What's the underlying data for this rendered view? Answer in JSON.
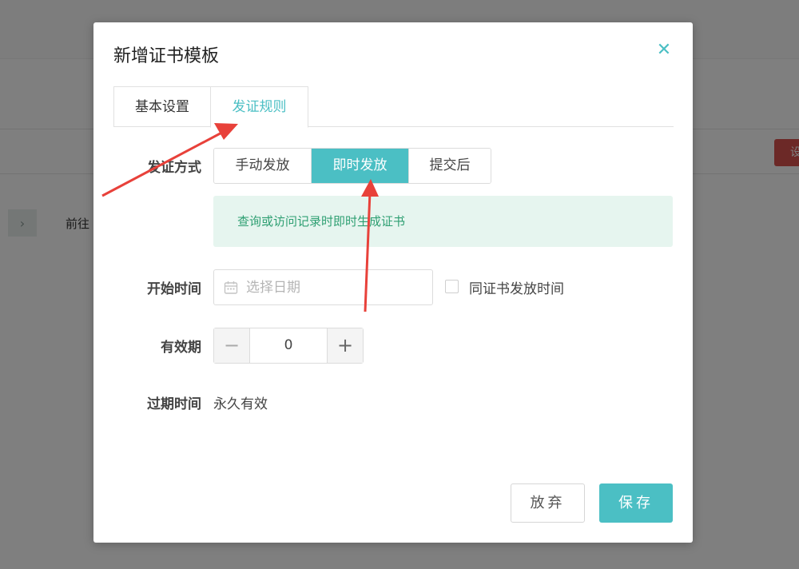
{
  "background": {
    "next_button_label": "前往",
    "red_button_label": "设"
  },
  "modal": {
    "title": "新增证书模板",
    "tabs": [
      {
        "label": "基本设置",
        "active": false
      },
      {
        "label": "发证规则",
        "active": true
      }
    ],
    "issue_method": {
      "label": "发证方式",
      "options": [
        "手动发放",
        "即时发放",
        "提交后"
      ],
      "selected": "即时发放",
      "hint": "查询或访问记录时即时生成证书"
    },
    "start_time": {
      "label": "开始时间",
      "placeholder": "选择日期",
      "value": "",
      "same_as_issue_label": "同证书发放时间",
      "same_as_issue_checked": false
    },
    "validity": {
      "label": "有效期",
      "value": "0",
      "minus": "−",
      "plus": "+"
    },
    "expire": {
      "label": "过期时间",
      "value": "永久有效"
    },
    "buttons": {
      "abandon": "放弃",
      "save": "保存"
    }
  },
  "colors": {
    "accent": "#4bbfc4",
    "hint_bg": "#e6f5ef",
    "hint_text": "#2e9f72",
    "annotation_arrow": "#e8413a"
  },
  "icons": {
    "close": "close-icon",
    "calendar": "calendar-icon",
    "chevron": "chevron-right-icon"
  }
}
